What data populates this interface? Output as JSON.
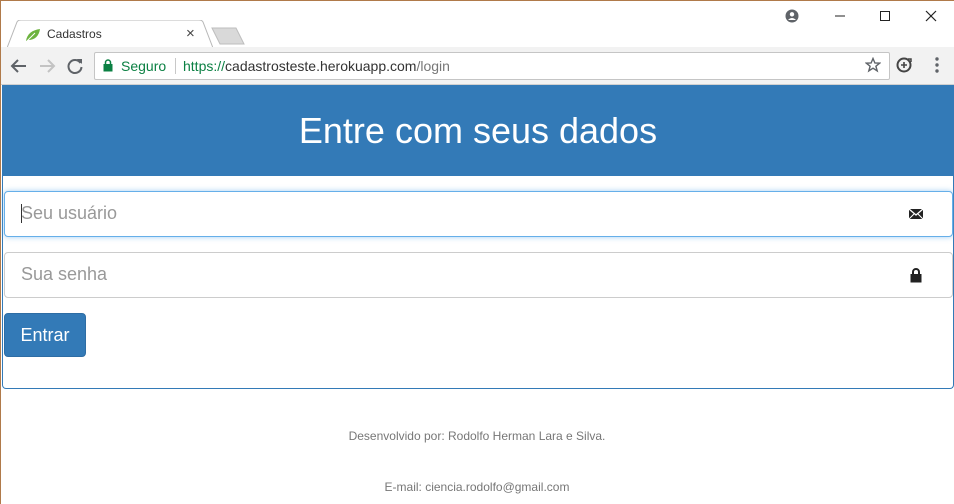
{
  "browser": {
    "tab_title": "Cadastros",
    "tab_close": "×",
    "secure_label": "Seguro",
    "url_scheme": "https://",
    "url_host": "cadastrosteste.herokuapp.com",
    "url_path": "/login"
  },
  "login": {
    "heading": "Entre com seus dados",
    "username_placeholder": "Seu usuário",
    "username_value": "",
    "password_placeholder": "Sua senha",
    "password_value": "",
    "submit_label": "Entrar"
  },
  "footer": {
    "developer": "Desenvolvido por: Rodolfo Herman Lara e Silva.",
    "email": "E-mail: ciencia.rodolfo@gmail.com"
  },
  "colors": {
    "primary": "#337ab7",
    "secure_green": "#0b8043"
  },
  "icons": {
    "username_addon": "envelope-icon",
    "password_addon": "lock-icon"
  }
}
